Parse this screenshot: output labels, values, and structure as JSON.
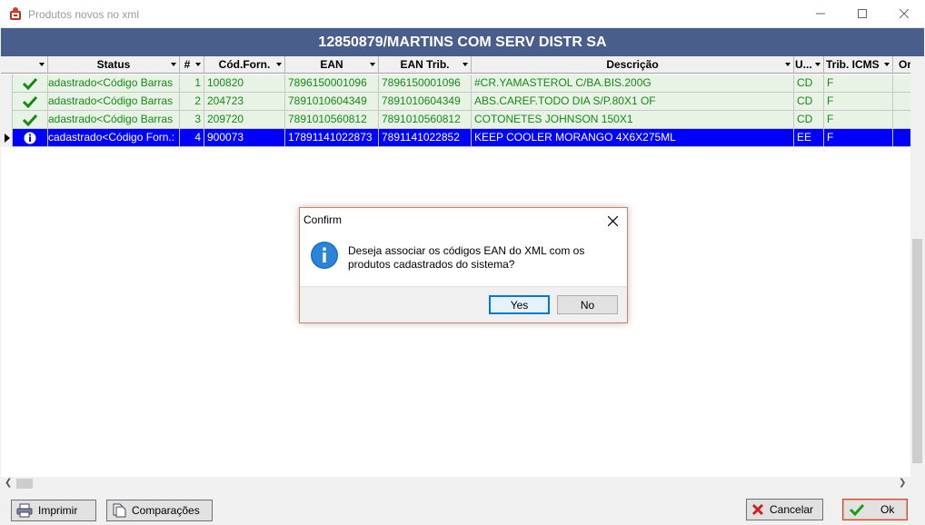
{
  "window": {
    "title": "Produtos novos no xml",
    "header": "12850879/MARTINS COM SERV DISTR SA"
  },
  "grid": {
    "columns": [
      {
        "label": ""
      },
      {
        "label": "Status"
      },
      {
        "label": "#"
      },
      {
        "label": "Cód.Forn."
      },
      {
        "label": "EAN"
      },
      {
        "label": "EAN Trib."
      },
      {
        "label": "Descrição"
      },
      {
        "label": "U..."
      },
      {
        "label": "Trib. ICMS"
      },
      {
        "label": "Or"
      }
    ],
    "rows": [
      {
        "status": "adastrado<Código Barras",
        "num": "1",
        "cod": "100820",
        "ean": "7896150001096",
        "ean_trib": "7896150001096",
        "desc": "#CR.YAMASTEROL C/BA.BIS.200G",
        "un": "CD",
        "icms": "F",
        "icon": "check-icon"
      },
      {
        "status": "adastrado<Código Barras",
        "num": "2",
        "cod": "204723",
        "ean": "7891010604349",
        "ean_trib": "7891010604349",
        "desc": "ABS.CAREF.TODO DIA S/P.80X1 OF",
        "un": "CD",
        "icms": "F",
        "icon": "check-icon"
      },
      {
        "status": "adastrado<Código Barras",
        "num": "3",
        "cod": "209720",
        "ean": "7891010560812",
        "ean_trib": "7891010560812",
        "desc": "COTONETES JOHNSON 150X1",
        "un": "CD",
        "icms": "F",
        "icon": "check-icon"
      },
      {
        "status": "cadastrado<Código Forn.:",
        "num": "4",
        "cod": "900073",
        "ean": "17891141022873",
        "ean_trib": "7891141022852",
        "desc": "KEEP COOLER MORANGO 4X6X275ML",
        "un": "EE",
        "icms": "F",
        "icon": "info-icon"
      }
    ]
  },
  "buttons": {
    "print": "Imprimir",
    "compare": "Comparações",
    "cancel": "Cancelar",
    "ok": "Ok"
  },
  "dialog": {
    "title": "Confirm",
    "message_line1": "Deseja associar os códigos EAN do XML com os",
    "message_line2": "produtos cadastrados do sistema?",
    "yes": "Yes",
    "no": "No"
  },
  "colors": {
    "header_band": "#4a5e8c",
    "row_green_text": "#148a14",
    "row_green_bg": "#e8f3e6",
    "selected_bg": "#0000ff"
  }
}
